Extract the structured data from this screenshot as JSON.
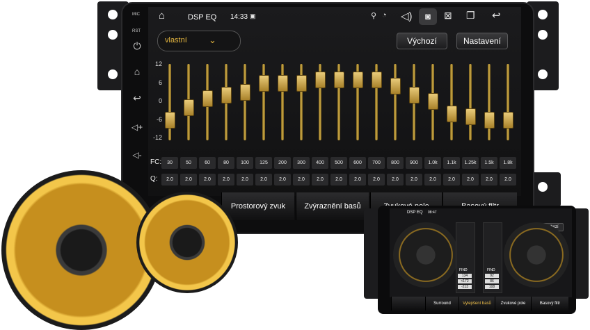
{
  "statusbar": {
    "title": "DSP EQ",
    "time": "14:33"
  },
  "side": {
    "mic": "MIC",
    "rst": "RST",
    "power": "⏻",
    "home": "⌂",
    "back": "↩",
    "vol_up": "◁+",
    "vol_down": "◁-"
  },
  "preset": {
    "value": "vlastní"
  },
  "buttons": {
    "default": "Výchozí",
    "settings": "Nastavení"
  },
  "eq": {
    "y_ticks": [
      "12",
      "6",
      "0",
      "-6",
      "-12"
    ],
    "fc_label": "FC:",
    "q_label": "Q:",
    "fc": [
      "30",
      "50",
      "60",
      "80",
      "100",
      "125",
      "200",
      "300",
      "400",
      "500",
      "600",
      "700",
      "800",
      "900",
      "1.0k",
      "1.1k",
      "1.25k",
      "1.5k",
      "1.8k"
    ],
    "q": [
      "2.0",
      "2.0",
      "2.0",
      "2.0",
      "2.0",
      "2.0",
      "2.0",
      "2.0",
      "2.0",
      "2.0",
      "2.0",
      "2.0",
      "2.0",
      "2.0",
      "2.0",
      "2.0",
      "2.0",
      "2.0",
      "2.0"
    ],
    "gains_db": [
      -6,
      -2,
      1,
      2,
      3,
      6,
      6,
      6,
      7,
      7,
      7,
      7,
      5,
      2,
      0,
      -4,
      -5,
      -6,
      -6
    ]
  },
  "tabs": [
    "Prostorový zvuk",
    "Zvýraznění basů",
    "Zvukové pole",
    "Basový filtr"
  ],
  "mini": {
    "title": "DSP EQ",
    "time": "08:47",
    "default": "Výchozí",
    "find": "FIND",
    "left_vals": [
      "134",
      "<172",
      "-213"
    ],
    "right_vals": [
      "92",
      "86",
      "108"
    ],
    "tabs": [
      "Surround",
      "Vylepšení basů",
      "Zvukové pole",
      "Basový filtr"
    ]
  }
}
